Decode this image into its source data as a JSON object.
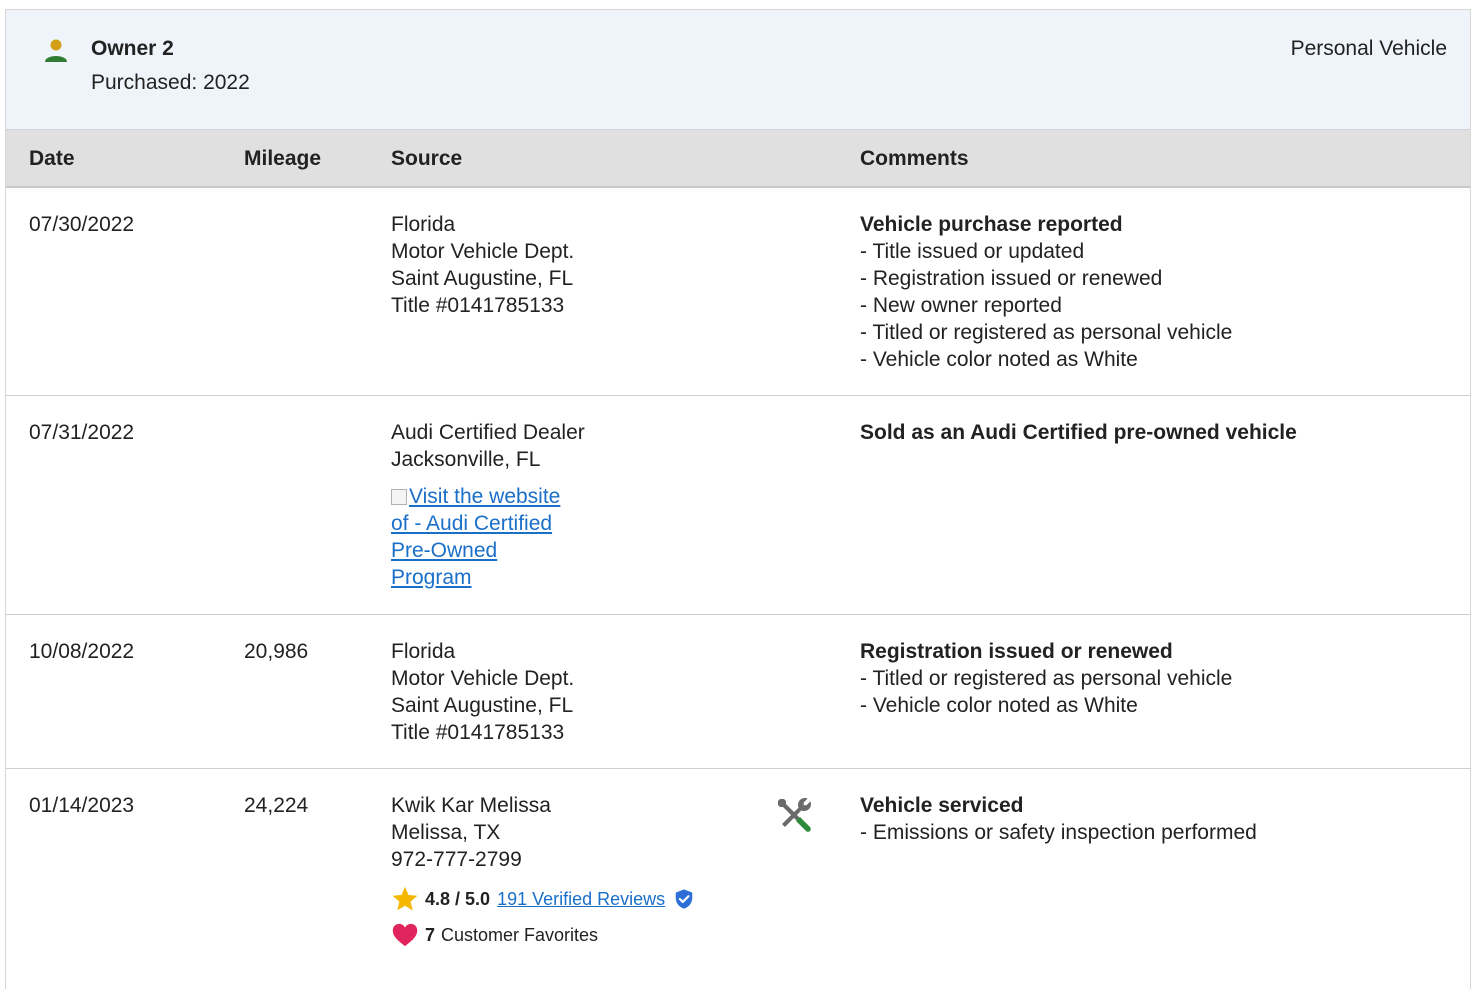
{
  "owner": {
    "title": "Owner 2",
    "purchased": "Purchased: 2022",
    "vehicle_type": "Personal Vehicle",
    "icon": "person-icon"
  },
  "table": {
    "headers": {
      "date": "Date",
      "mileage": "Mileage",
      "source": "Source",
      "comments": "Comments"
    },
    "rows": [
      {
        "date": "07/30/2022",
        "mileage": "",
        "source": [
          "Florida",
          "Motor Vehicle Dept.",
          "Saint Augustine, FL",
          "Title #0141785133"
        ],
        "comment_title": "Vehicle purchase reported",
        "comment_items": [
          "- Title issued or updated",
          "- Registration issued or renewed",
          "- New owner reported",
          "- Titled or registered as personal vehicle",
          "- Vehicle color noted as White"
        ]
      },
      {
        "date": "07/31/2022",
        "mileage": "",
        "source": [
          "Audi Certified Dealer",
          "Jacksonville, FL"
        ],
        "source_link": "Visit the website of - Audi Certified Pre-Owned Program",
        "comment_title": "Sold as an Audi Certified pre-owned vehicle",
        "comment_items": []
      },
      {
        "date": "10/08/2022",
        "mileage": "20,986",
        "source": [
          "Florida",
          "Motor Vehicle Dept.",
          "Saint Augustine, FL",
          "Title #0141785133"
        ],
        "comment_title": "Registration issued or renewed",
        "comment_items": [
          "- Titled or registered as personal vehicle",
          "- Vehicle color noted as White"
        ]
      },
      {
        "date": "01/14/2023",
        "mileage": "24,224",
        "source": [
          "Kwik Kar Melissa",
          "Melissa, TX",
          "972-777-2799"
        ],
        "rating": "4.8 / 5.0",
        "reviews_link": "191 Verified Reviews",
        "favorites_count": "7",
        "favorites_label": "Customer Favorites",
        "icon": "service-tools-icon",
        "comment_title": "Vehicle serviced",
        "comment_items": [
          "- Emissions or safety inspection performed"
        ]
      }
    ]
  },
  "colors": {
    "header_bg": "#eef4fa",
    "table_head_bg": "#e0e0e0",
    "link": "#1a6fc9",
    "person_icon_body": "#2e7d32",
    "person_icon_head": "#d4a017",
    "star": "#f5b800",
    "heart": "#e0245e",
    "wrench_green": "#2e8b3a",
    "shield": "#2d6fd6"
  }
}
